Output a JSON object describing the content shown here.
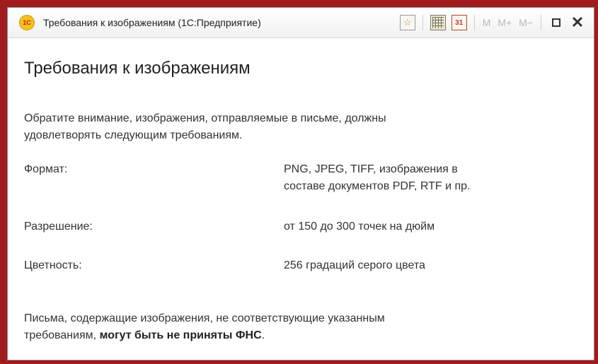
{
  "window": {
    "title": "Требования к изображениям  (1С:Предприятие)",
    "app_icon_glyph": "1С",
    "memory_buttons": [
      "M",
      "M+",
      "M−"
    ]
  },
  "content": {
    "heading": "Требования к изображениям",
    "intro_line1": "Обратите внимание, изображения, отправляемые в письме, должны",
    "intro_line2": "удовлетворять следующим требованиям.",
    "requirements": [
      {
        "label": "Формат:",
        "value_line1": "PNG, JPEG, TIFF, изображения в",
        "value_line2": "составе документов PDF, RTF и пр."
      },
      {
        "label": "Разрешение:",
        "value_line1": "от 150 до 300 точек на дюйм"
      },
      {
        "label": "Цветность:",
        "value_line1": "256 градаций серого цвета"
      }
    ],
    "footer_line1": "Письма, содержащие изображения, не соответствующие указанным",
    "footer_line2_prefix": "требованиям, ",
    "footer_line2_bold": "могут быть не приняты ФНС",
    "footer_line2_suffix": "."
  },
  "colors": {
    "frame": "#a11c1c",
    "app_icon": "#f2c21b"
  },
  "icons": {
    "favorite": "star-icon",
    "calculator": "calculator-icon",
    "calendar": "calendar-icon",
    "maximize": "maximize-icon",
    "close": "close-icon"
  }
}
